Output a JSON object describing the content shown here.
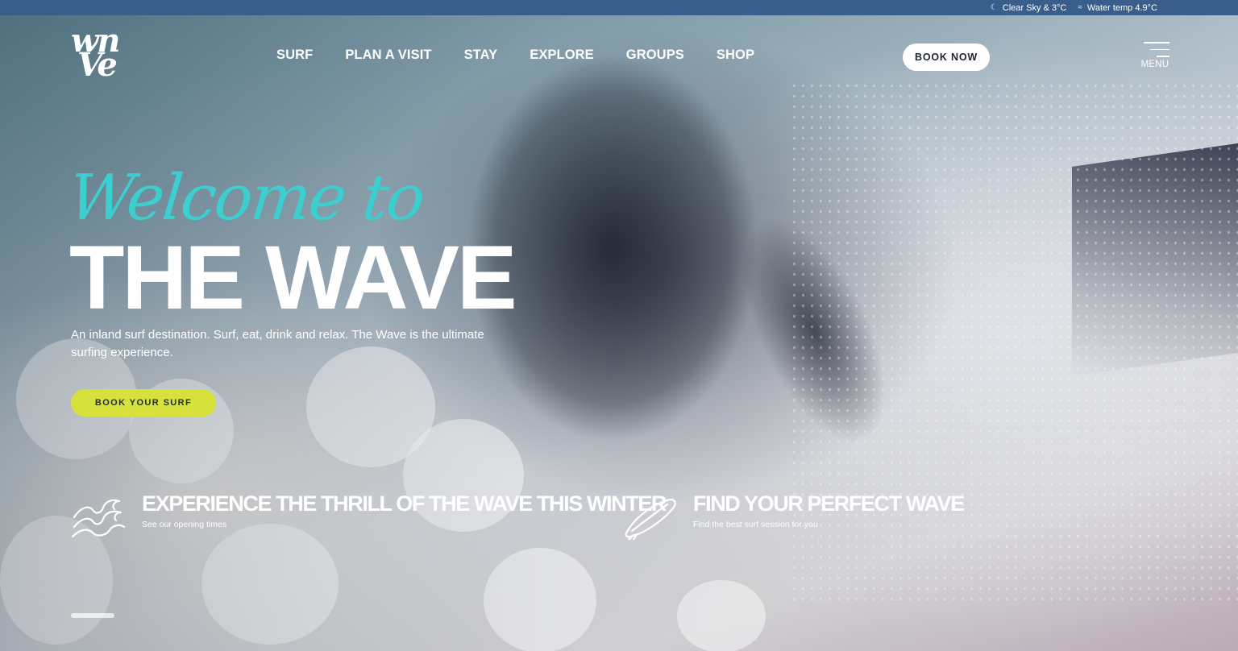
{
  "topbar": {
    "weather_icon": "moon-icon",
    "weather": "Clear Sky & 3°C",
    "water_icon": "swimmer-icon",
    "water": "Water temp 4.9°C"
  },
  "header": {
    "logo_line1": "wn",
    "logo_line2": "Ve",
    "nav": [
      "SURF",
      "PLAN A VISIT",
      "STAY",
      "EXPLORE",
      "GROUPS",
      "SHOP"
    ],
    "book_now": "BOOK NOW",
    "menu_label": "MENU"
  },
  "hero": {
    "welcome": "Welcome to",
    "title": "THE WAVE",
    "tagline": "An inland surf destination. Surf, eat, drink and relax. The Wave is the ultimate surfing experience.",
    "cta": "BOOK YOUR SURF"
  },
  "features": [
    {
      "icon": "wave-icon",
      "title": "EXPERIENCE THE THRILL OF THE WAVE THIS WINTER",
      "subtitle": "See our opening times"
    },
    {
      "icon": "surfboard-icon",
      "title": "FIND YOUR PERFECT WAVE",
      "subtitle": "Find the best surf session for you"
    }
  ],
  "colors": {
    "topbar": "#3a5e8c",
    "accent_teal": "#3ccfd0",
    "cta_yellow": "#d6e23b"
  }
}
